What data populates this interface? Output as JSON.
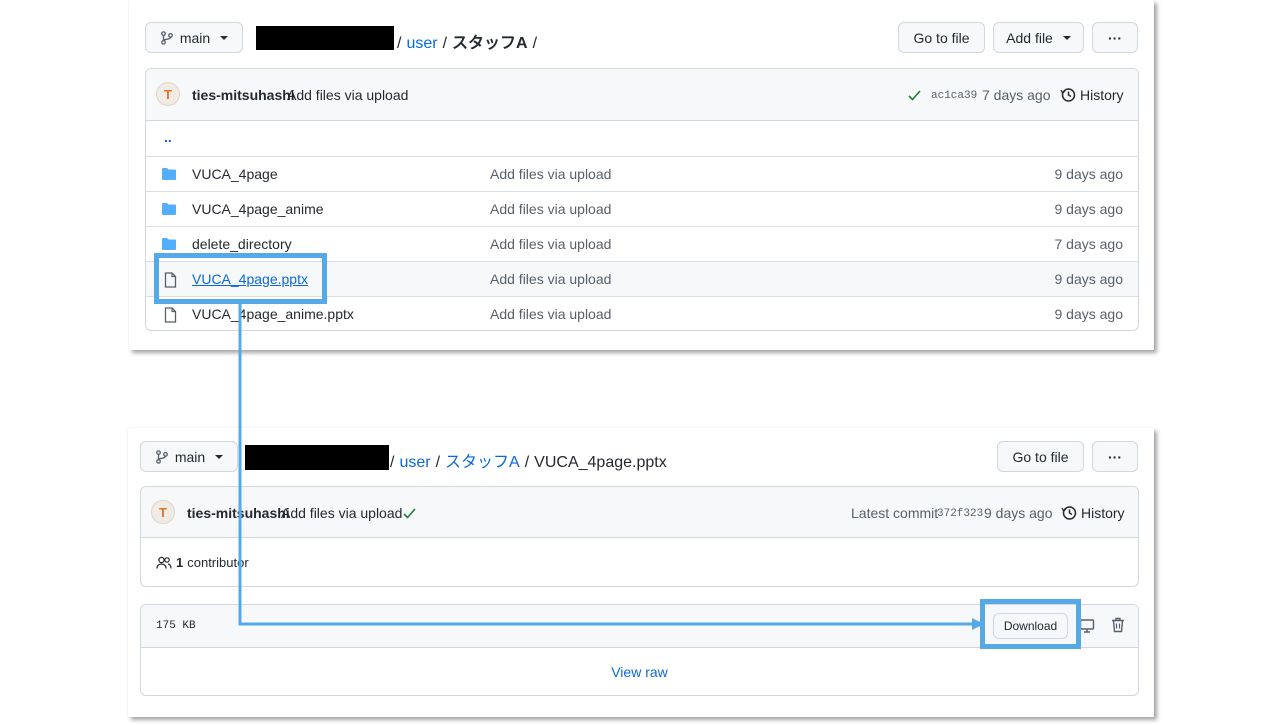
{
  "top": {
    "branch": "main",
    "breadcrumb": {
      "sep1": "/",
      "user": "user",
      "sep2": "/",
      "folder": "スタッフA",
      "sep3": "/"
    },
    "go_to_file": "Go to file",
    "add_file": "Add file",
    "more": "···",
    "commit": {
      "author": "ties-mitsuhashi",
      "message": "Add files via upload",
      "hash": "ac1ca39",
      "time": "7 days ago",
      "history": "History"
    },
    "parent_link": "..",
    "files": [
      {
        "type": "folder",
        "name": "VUCA_4page",
        "message": "Add files via upload",
        "time": "9 days ago"
      },
      {
        "type": "folder",
        "name": "VUCA_4page_anime",
        "message": "Add files via upload",
        "time": "9 days ago"
      },
      {
        "type": "folder",
        "name": "delete_directory",
        "message": "Add files via upload",
        "time": "7 days ago"
      },
      {
        "type": "file",
        "name": "VUCA_4page.pptx",
        "message": "Add files via upload",
        "time": "9 days ago"
      },
      {
        "type": "file",
        "name": "VUCA_4page_anime.pptx",
        "message": "Add files via upload",
        "time": "9 days ago"
      }
    ]
  },
  "bottom": {
    "branch": "main",
    "breadcrumb": {
      "sep1": "/",
      "user": "user",
      "sep2": "/",
      "folder": "スタッフA",
      "sep3": "/",
      "file": "VUCA_4page.pptx"
    },
    "go_to_file": "Go to file",
    "more": "···",
    "commit": {
      "author": "ties-mitsuhashi",
      "message": "Add files via upload",
      "latest_label": "Latest commit",
      "hash": "372f323",
      "time": "9 days ago",
      "history": "History"
    },
    "contributors": {
      "count": "1",
      "label": "contributor"
    },
    "file_size": "175 KB",
    "download": "Download",
    "view_raw": "View raw"
  },
  "colors": {
    "link": "#0969da",
    "highlight": "#55a9e6",
    "check": "#1a7f37",
    "folder": "#54aeff"
  }
}
